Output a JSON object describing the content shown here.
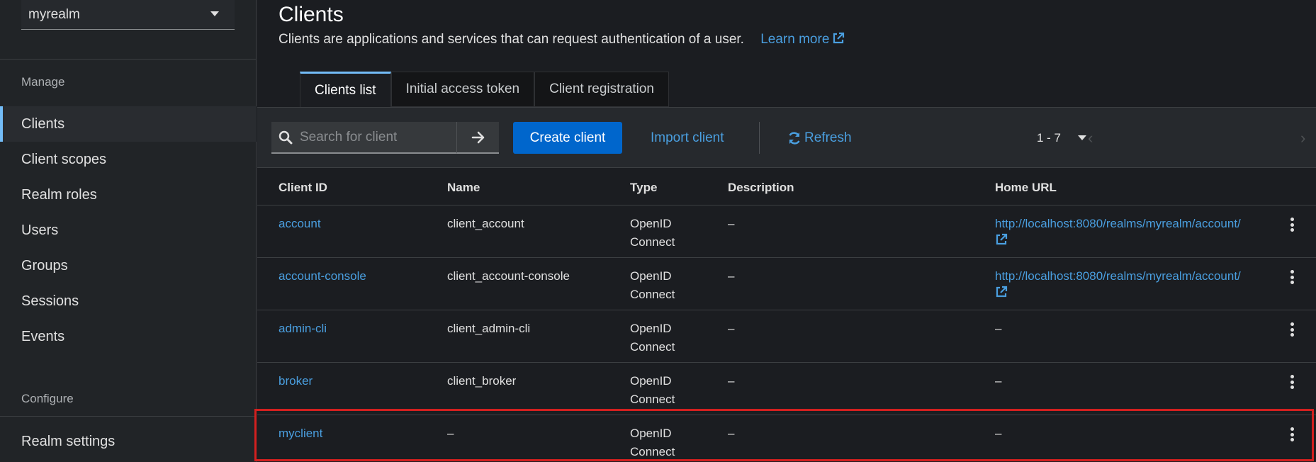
{
  "sidebar": {
    "realm": "myrealm",
    "manage_title": "Manage",
    "items": [
      {
        "label": "Clients",
        "active": true
      },
      {
        "label": "Client scopes"
      },
      {
        "label": "Realm roles"
      },
      {
        "label": "Users"
      },
      {
        "label": "Groups"
      },
      {
        "label": "Sessions"
      },
      {
        "label": "Events"
      }
    ],
    "configure_title": "Configure",
    "configure_items": [
      {
        "label": "Realm settings"
      }
    ]
  },
  "page": {
    "title": "Clients",
    "description": "Clients are applications and services that can request authentication of a user.",
    "learn_more": "Learn more"
  },
  "tabs": [
    {
      "label": "Clients list",
      "active": true
    },
    {
      "label": "Initial access token"
    },
    {
      "label": "Client registration"
    }
  ],
  "toolbar": {
    "search_placeholder": "Search for client",
    "create_label": "Create client",
    "import_label": "Import client",
    "refresh_label": "Refresh",
    "pagination": "1 - 7"
  },
  "table": {
    "columns": [
      "Client ID",
      "Name",
      "Type",
      "Description",
      "Home URL"
    ],
    "rows": [
      {
        "client_id": "account",
        "name": "client_account",
        "type_line1": "OpenID",
        "type_line2": "Connect",
        "description": "–",
        "home_url": "http://localhost:8080/realms/myrealm/account/"
      },
      {
        "client_id": "account-console",
        "name": "client_account-console",
        "type_line1": "OpenID",
        "type_line2": "Connect",
        "description": "–",
        "home_url": "http://localhost:8080/realms/myrealm/account/"
      },
      {
        "client_id": "admin-cli",
        "name": "client_admin-cli",
        "type_line1": "OpenID",
        "type_line2": "Connect",
        "description": "–",
        "home_url": "–"
      },
      {
        "client_id": "broker",
        "name": "client_broker",
        "type_line1": "OpenID",
        "type_line2": "Connect",
        "description": "–",
        "home_url": "–"
      },
      {
        "client_id": "myclient",
        "name": "–",
        "type_line1": "OpenID",
        "type_line2": "Connect",
        "description": "–",
        "home_url": "–"
      }
    ]
  },
  "colors": {
    "accent": "#73bcf7",
    "link": "#4a9fe0",
    "primary_button": "#0066cc",
    "highlight": "#d3201f"
  }
}
